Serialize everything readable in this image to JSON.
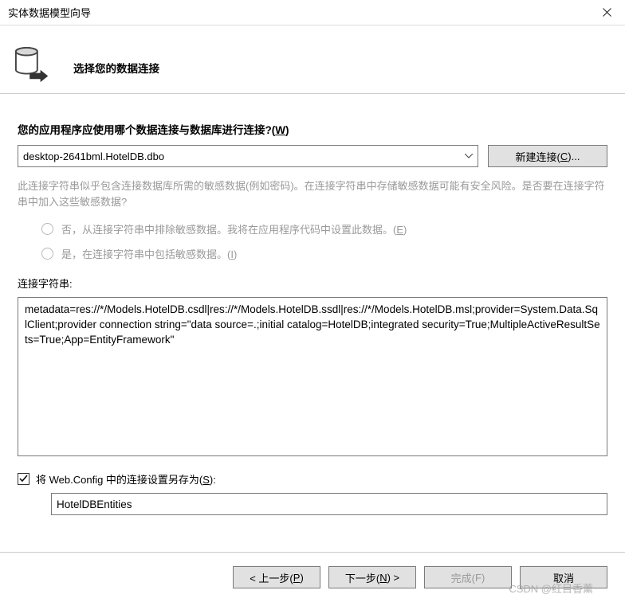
{
  "window": {
    "title": "实体数据模型向导"
  },
  "header": {
    "title": "选择您的数据连接"
  },
  "connection": {
    "prompt_prefix": "您的应用程序应使用哪个数据连接与数据库进行连接?(",
    "prompt_key": "W",
    "prompt_suffix": ")",
    "selected": "desktop-2641bml.HotelDB.dbo",
    "new_button_prefix": "新建连接(",
    "new_button_key": "C",
    "new_button_suffix": ")..."
  },
  "sensitive": {
    "warning": "此连接字符串似乎包含连接数据库所需的敏感数据(例如密码)。在连接字符串中存储敏感数据可能有安全风险。是否要在连接字符串中加入这些敏感数据?",
    "opt_no_prefix": "否，从连接字符串中排除敏感数据。我将在应用程序代码中设置此数据。(",
    "opt_no_key": "E",
    "opt_no_suffix": ")",
    "opt_yes_prefix": "是，在连接字符串中包括敏感数据。(",
    "opt_yes_key": "I",
    "opt_yes_suffix": ")"
  },
  "conn_string": {
    "label": "连接字符串:",
    "value": "metadata=res://*/Models.HotelDB.csdl|res://*/Models.HotelDB.ssdl|res://*/Models.HotelDB.msl;provider=System.Data.SqlClient;provider connection string=\"data source=.;initial catalog=HotelDB;integrated security=True;MultipleActiveResultSets=True;App=EntityFramework\""
  },
  "save_config": {
    "label_prefix": "将 Web.Config 中的连接设置另存为(",
    "label_key": "S",
    "label_suffix": "):",
    "checked": true,
    "value": "HotelDBEntities"
  },
  "footer": {
    "prev_prefix": "< 上一步(",
    "prev_key": "P",
    "prev_suffix": ")",
    "next_prefix": "下一步(",
    "next_key": "N",
    "next_suffix": ") >",
    "finish_prefix": "完成(",
    "finish_key": "F",
    "finish_suffix": ")",
    "cancel": "取消"
  },
  "watermark": "CSDN @红目香薰"
}
